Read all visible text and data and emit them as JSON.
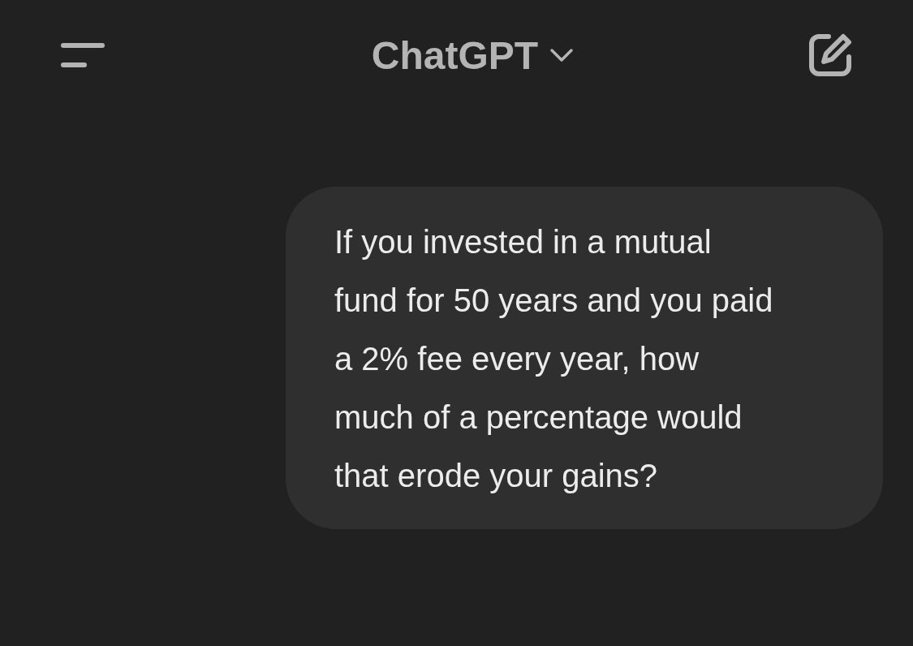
{
  "header": {
    "title": "ChatGPT"
  },
  "messages": [
    {
      "kind": "sent",
      "text": "If you invested in a mutual fund for 50 years and you paid a 2% fee every year, how much of a percentage would that erode your gains?"
    }
  ]
}
